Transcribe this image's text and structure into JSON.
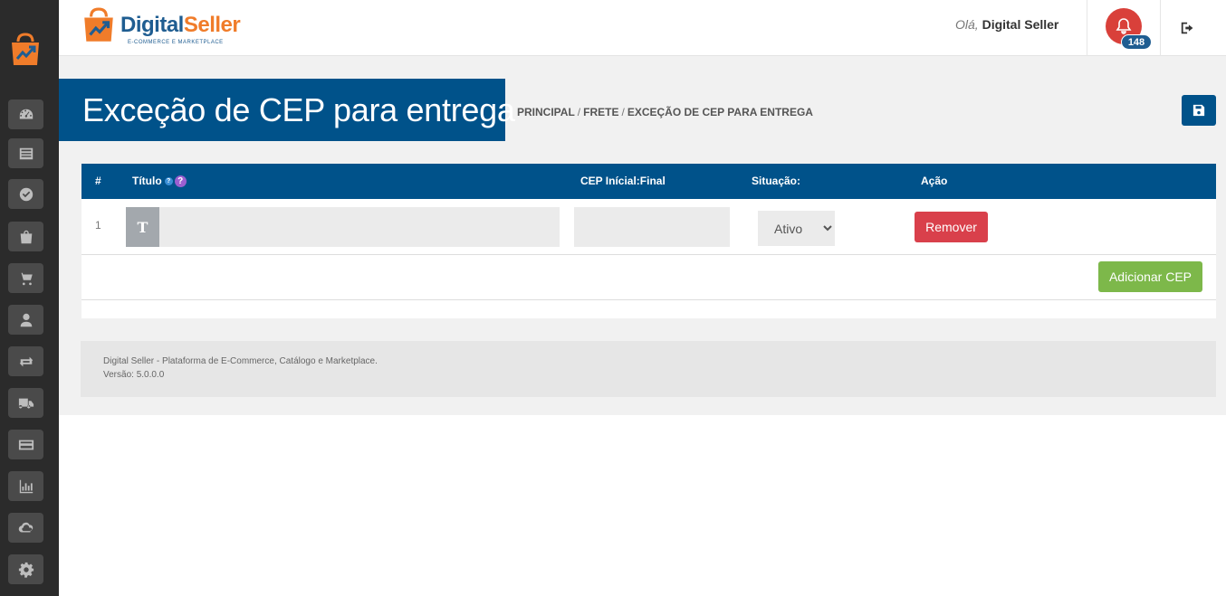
{
  "brand": {
    "name_part1": "Digital",
    "name_part2": "Seller",
    "tagline": "E-COMMERCE E MARKETPLACE"
  },
  "header": {
    "greeting": "Olá,",
    "user_name": "Digital Seller",
    "notification_count": "148"
  },
  "sidebar": {
    "items": [
      {
        "icon": "dashboard-icon"
      },
      {
        "icon": "list-icon"
      },
      {
        "icon": "check-circle-icon"
      },
      {
        "icon": "shopping-bag-icon"
      },
      {
        "icon": "cart-icon"
      },
      {
        "icon": "user-icon"
      },
      {
        "icon": "exchange-icon"
      },
      {
        "icon": "truck-icon"
      },
      {
        "icon": "credit-card-icon"
      },
      {
        "icon": "bar-chart-icon"
      },
      {
        "icon": "cloud-icon"
      },
      {
        "icon": "gear-icon"
      }
    ]
  },
  "page": {
    "title": "Exceção de CEP para entrega",
    "breadcrumb": [
      "PRINCIPAL",
      "FRETE",
      "EXCEÇÃO DE CEP PARA ENTREGA"
    ],
    "breadcrumb_sep": "/"
  },
  "table": {
    "headers": {
      "num": "#",
      "title": "Título",
      "cep": "CEP Inícial:Final",
      "status": "Situação:",
      "action": "Ação"
    },
    "rows": [
      {
        "num": "1",
        "title": "",
        "cep": "",
        "status": "Ativo",
        "remove_label": "Remover"
      }
    ],
    "status_options": [
      "Ativo"
    ],
    "add_label": "Adicionar CEP"
  },
  "footer": {
    "line1": "Digital Seller - Plataforma de E-Commerce, Catálogo e Marketplace.",
    "line2": "Versão: 5.0.0.0"
  },
  "colors": {
    "primary": "#00528a",
    "danger": "#d9404b",
    "success": "#7db84a",
    "sidebar": "#2b2b2b",
    "bell": "#d9403a"
  }
}
